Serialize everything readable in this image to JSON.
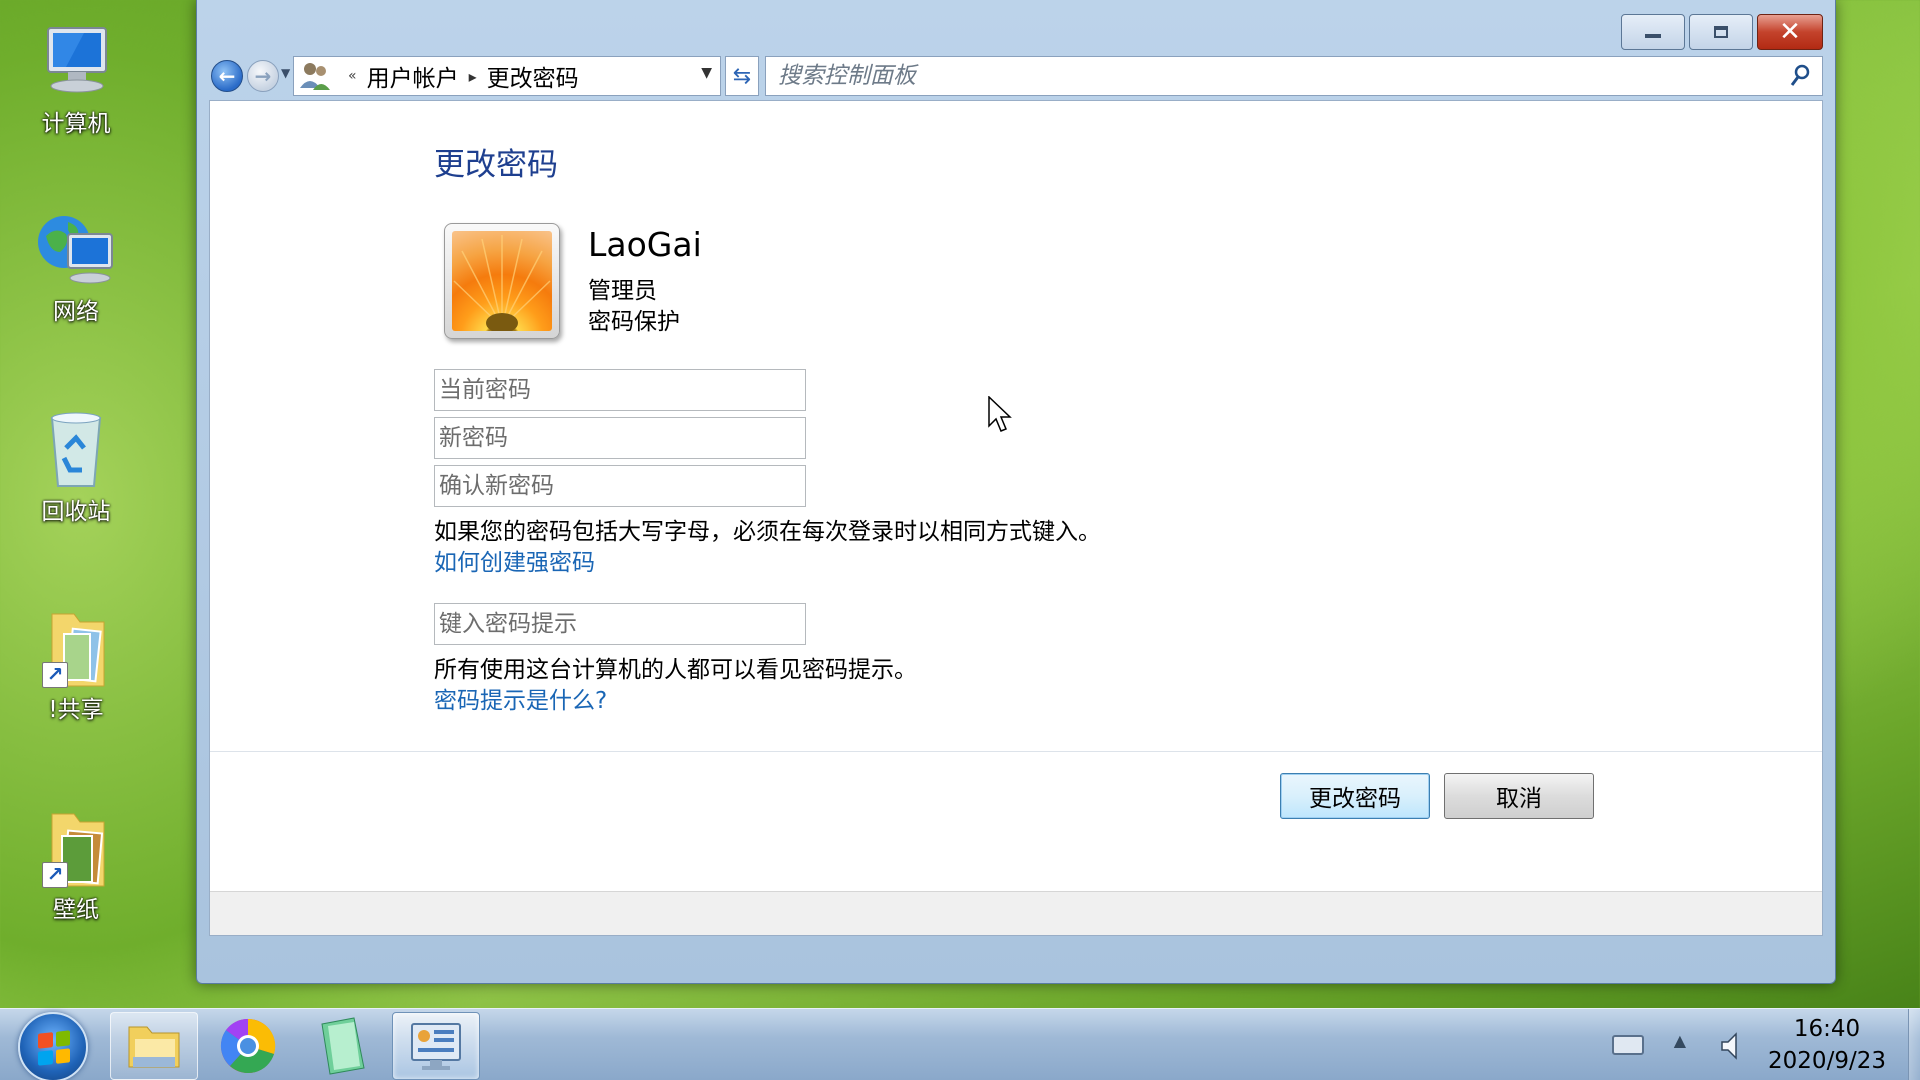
{
  "desktop": {
    "icons": [
      {
        "label": "计算机"
      },
      {
        "label": "网络"
      },
      {
        "label": "回收站"
      },
      {
        "label": "!共享"
      },
      {
        "label": "壁纸"
      }
    ]
  },
  "window": {
    "breadcrumb": {
      "overflow": "«",
      "parent": "用户帐户",
      "current": "更改密码"
    },
    "search_placeholder": "搜索控制面板",
    "page_title": "更改密码",
    "user": {
      "name": "LaoGai",
      "role": "管理员",
      "status": "密码保护"
    },
    "fields": {
      "current_password_placeholder": "当前密码",
      "new_password_placeholder": "新密码",
      "confirm_password_placeholder": "确认新密码",
      "hint_placeholder": "键入密码提示"
    },
    "case_note": "如果您的密码包括大写字母，必须在每次登录时以相同方式键入。",
    "strong_password_link": "如何创建强密码",
    "hint_note": "所有使用这台计算机的人都可以看见密码提示。",
    "hint_link": "密码提示是什么?",
    "buttons": {
      "change": "更改密码",
      "cancel": "取消"
    }
  },
  "taskbar": {
    "clock_time": "16:40",
    "clock_date": "2020/9/23"
  }
}
